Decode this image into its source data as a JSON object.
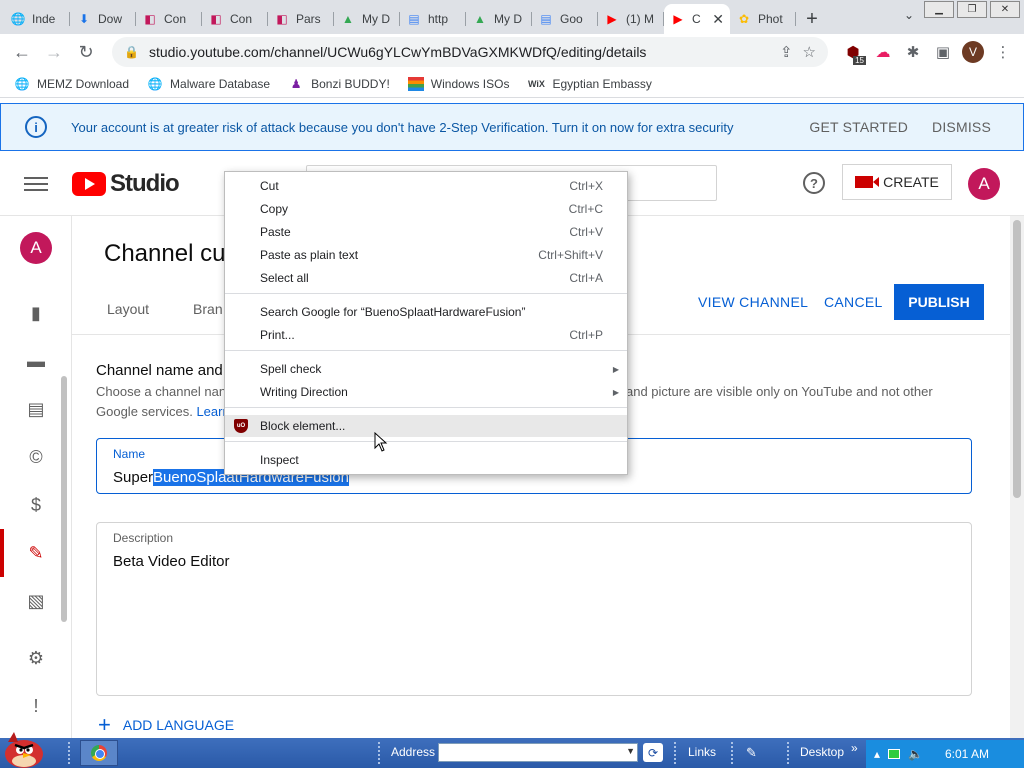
{
  "browser": {
    "tabs": [
      {
        "label": "Inde",
        "icon": "globe-icon",
        "color": "#5f6368"
      },
      {
        "label": "Dow",
        "icon": "download-icon",
        "color": "#1a73e8"
      },
      {
        "label": "Con",
        "icon": "bracket-icon",
        "color": "#c2185b"
      },
      {
        "label": "Con",
        "icon": "bracket-icon",
        "color": "#c2185b"
      },
      {
        "label": "Pars",
        "icon": "bracket-icon",
        "color": "#c2185b"
      },
      {
        "label": "My D",
        "icon": "drive-icon",
        "color": "#34a853"
      },
      {
        "label": "http",
        "icon": "docs-icon",
        "color": "#4285f4"
      },
      {
        "label": "My D",
        "icon": "drive-icon",
        "color": "#34a853"
      },
      {
        "label": "Goo",
        "icon": "docs-icon",
        "color": "#4285f4"
      },
      {
        "label": "(1) M",
        "icon": "youtube-icon",
        "color": "#ff0000"
      },
      {
        "label": "C",
        "icon": "youtube-icon",
        "color": "#ff0000",
        "active": true
      },
      {
        "label": "Phot",
        "icon": "photos-icon",
        "color": "#fbbc05"
      }
    ],
    "url": "studio.youtube.com/channel/UCWu6gYLCwYmBDVaGXMKWDfQ/editing/details",
    "profile_initial": "V",
    "ext_badge": "15",
    "bookmarks": [
      {
        "label": "MEMZ Download",
        "icon": "globe-icon"
      },
      {
        "label": "Malware Database",
        "icon": "globe-icon"
      },
      {
        "label": "Bonzi BUDDY!",
        "icon": "bonzi-icon"
      },
      {
        "label": "Windows ISOs",
        "icon": "windows-flag-icon"
      },
      {
        "label": "Egyptian Embassy",
        "icon": "wix-icon",
        "icon_text": "WiX"
      }
    ]
  },
  "banner": {
    "message": "Your account is at greater risk of attack because you don't have 2-Step Verification. Turn it on now for extra security",
    "get_started": "GET STARTED",
    "dismiss": "DISMISS"
  },
  "studio": {
    "logo_text": "Studio",
    "help": "?",
    "create_label": "CREATE",
    "avatar_initial": "A",
    "page_title": "Channel cu",
    "tabs": [
      "Layout",
      "Bran"
    ],
    "view_channel": "VIEW CHANNEL",
    "cancel": "CANCEL",
    "publish": "PUBLISH",
    "section_title": "Channel name and",
    "section_desc_left": "Choose a channel nan",
    "section_desc_right": "and picture are visible only on YouTube and not other",
    "section_desc_line2": "Google services.",
    "learn_more": "Learr",
    "name_label": "Name",
    "name_prefix": "Super",
    "name_selected": "BuenoSplaatHardwareFusion",
    "description_label": "Description",
    "description_value": "Beta Video Editor",
    "add_language": "ADD LANGUAGE"
  },
  "context_menu": {
    "items": [
      {
        "label": "Cut",
        "shortcut": "Ctrl+X"
      },
      {
        "label": "Copy",
        "shortcut": "Ctrl+C"
      },
      {
        "label": "Paste",
        "shortcut": "Ctrl+V"
      },
      {
        "label": "Paste as plain text",
        "shortcut": "Ctrl+Shift+V"
      },
      {
        "label": "Select all",
        "shortcut": "Ctrl+A"
      },
      {
        "label": "Search Google for “BuenoSplaatHardwareFusion”",
        "shortcut": ""
      },
      {
        "label": "Print...",
        "shortcut": "Ctrl+P"
      },
      {
        "label": "Spell check",
        "shortcut": ""
      },
      {
        "label": "Writing Direction",
        "shortcut": ""
      },
      {
        "label": "Block element...",
        "shortcut": ""
      },
      {
        "label": "Inspect",
        "shortcut": ""
      }
    ]
  },
  "taskbar": {
    "address_label": "Address",
    "links_label": "Links",
    "desktop_label": "Desktop",
    "chevrons": "»",
    "clock": "6:01 AM"
  }
}
